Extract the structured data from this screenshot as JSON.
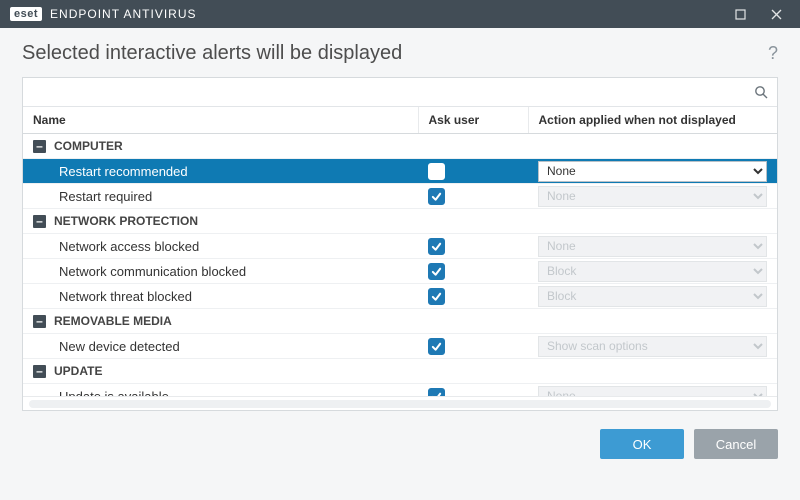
{
  "titlebar": {
    "brand": "eset",
    "product": "ENDPOINT ANTIVIRUS"
  },
  "page": {
    "title": "Selected interactive alerts will be displayed"
  },
  "columns": {
    "name": "Name",
    "ask": "Ask user",
    "action": "Action applied when not displayed"
  },
  "groups": [
    {
      "label": "COMPUTER",
      "items": [
        {
          "name": "Restart recommended",
          "ask": false,
          "action": "None",
          "action_enabled": true,
          "selected": true
        },
        {
          "name": "Restart required",
          "ask": true,
          "action": "None",
          "action_enabled": false
        }
      ]
    },
    {
      "label": "NETWORK PROTECTION",
      "items": [
        {
          "name": "Network access blocked",
          "ask": true,
          "action": "None",
          "action_enabled": false
        },
        {
          "name": "Network communication blocked",
          "ask": true,
          "action": "Block",
          "action_enabled": false
        },
        {
          "name": "Network threat blocked",
          "ask": true,
          "action": "Block",
          "action_enabled": false
        }
      ]
    },
    {
      "label": "REMOVABLE MEDIA",
      "items": [
        {
          "name": "New device detected",
          "ask": true,
          "action": "Show scan options",
          "action_enabled": false
        }
      ]
    },
    {
      "label": "UPDATE",
      "items": [
        {
          "name": "Update is available",
          "ask": true,
          "action": "None",
          "action_enabled": false
        }
      ]
    }
  ],
  "buttons": {
    "ok": "OK",
    "cancel": "Cancel"
  }
}
